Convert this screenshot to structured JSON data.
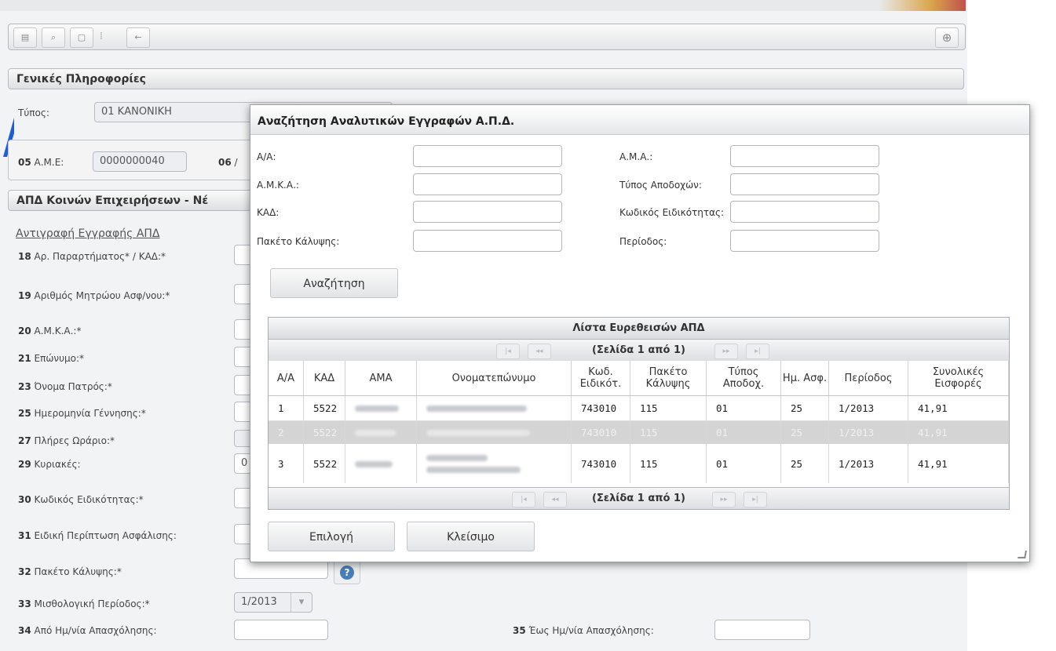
{
  "toolbar": {
    "icons": [
      "save-icon",
      "search-icon",
      "new-document-icon",
      "separator-icon",
      "back-arrow-icon"
    ],
    "glyphs": [
      "▤",
      "⌕",
      "▢",
      "⁞",
      "←"
    ],
    "add_glyph": "⊕"
  },
  "general": {
    "header": "Γενικές Πληροφορίες",
    "type_label": "Τύπος:",
    "type_value": "01 ΚΑΝΟΝΙΚΗ",
    "ame_num": "05",
    "ame_label": "Α.Μ.Ε:",
    "ame_value": "0000000040",
    "field06_num": "06",
    "field06_label": "/"
  },
  "apd": {
    "header": "ΑΠΔ Κοινών Επιχειρήσεων - Νέ",
    "copy_link": "Αντιγραφή Εγγραφής ΑΠΔ",
    "fields": [
      {
        "num": "18",
        "label": "Αρ. Παραρτήματος* / ΚΑΔ:*"
      },
      {
        "num": "19",
        "label": "Αριθμός Μητρώου Ασφ/νου:*"
      },
      {
        "num": "20",
        "label": "Α.Μ.Κ.Α.:*"
      },
      {
        "num": "21",
        "label": "Επώνυμο:*"
      },
      {
        "num": "23",
        "label": "Όνομα Πατρός:*"
      },
      {
        "num": "25",
        "label": "Ημερομηνία Γέννησης:*"
      },
      {
        "num": "27",
        "label": "Πλήρες Ωράριο:*"
      },
      {
        "num": "29",
        "label": "Κυριακές:"
      },
      {
        "num": "30",
        "label": "Κωδικός Ειδικότητας:*"
      },
      {
        "num": "31",
        "label": "Ειδική Περίπτωση Ασφάλισης:"
      },
      {
        "num": "32",
        "label": "Πακέτο Κάλυψης:*"
      },
      {
        "num": "33",
        "label": "Μισθολογική Περίοδος:*"
      },
      {
        "num": "34",
        "label": "Από Ημ/νία Απασχόλησης:"
      }
    ],
    "sundays_value": "0",
    "period_value": "1/2013",
    "period_arrow": "▾",
    "field35_num": "35",
    "field35_label": "Έως Ημ/νία Απασχόλησης:",
    "help_glyph": "?"
  },
  "dialog": {
    "title": "Αναζήτηση Αναλυτικών Εγγραφών Α.Π.Δ.",
    "left_labels": [
      "Α/Α:",
      "Α.Μ.Κ.Α.:",
      "ΚΑΔ:",
      "Πακέτο Κάλυψης:"
    ],
    "right_labels": [
      "Α.Μ.Α.:",
      "Τύπος Αποδοχών:",
      "Κωδικός Ειδικότητας:",
      "Περίοδος:"
    ],
    "search_button": "Αναζήτηση",
    "select_button": "Επιλογή",
    "close_button": "Κλείσιμο"
  },
  "grid": {
    "title": "Λίστα Ευρεθεισών ΑΠΔ",
    "pager_text": "(Σελίδα 1 από 1)",
    "pager_glyphs": {
      "first": "|◂",
      "prev": "◂◂",
      "next": "▸▸",
      "last": "▸|"
    },
    "columns": [
      "Α/Α",
      "ΚΑΔ",
      "ΑΜΑ",
      "Ονοματεπώνυμο",
      "Κωδ. Ειδικότ.",
      "Πακέτο Κάλυψης",
      "Τύπος Αποδοχ.",
      "Ημ. Ασφ.",
      "Περίοδος",
      "Συνολικές Εισφορές"
    ],
    "rows": [
      {
        "aa": "1",
        "kad": "5522",
        "spec": "743010",
        "pkg": "115",
        "type": "01",
        "days": "25",
        "period": "1/2013",
        "total": "41,91"
      },
      {
        "aa": "2",
        "kad": "5522",
        "spec": "743010",
        "pkg": "115",
        "type": "01",
        "days": "25",
        "period": "1/2013",
        "total": "41,91"
      },
      {
        "aa": "3",
        "kad": "5522",
        "spec": "743010",
        "pkg": "115",
        "type": "01",
        "days": "25",
        "period": "1/2013",
        "total": "41,91"
      }
    ]
  },
  "colors": {
    "accent_blue": "#1f5fd6",
    "help_blue": "#4a7fb6",
    "selected_row": "#d4d4d4"
  }
}
